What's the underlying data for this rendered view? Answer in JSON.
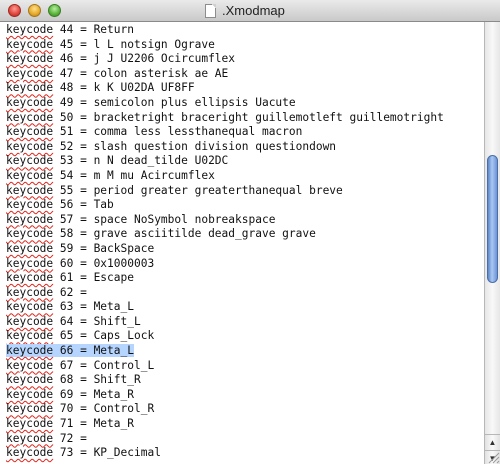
{
  "window": {
    "title": ".Xmodmap",
    "file_icon": "document-icon"
  },
  "editor": {
    "lines": [
      [
        "keycode",
        " 44 = Return"
      ],
      [
        "keycode",
        " 45 = l L notsign Ograve"
      ],
      [
        "keycode",
        " 46 = j J U2206 Ocircumflex"
      ],
      [
        "keycode",
        " 47 = colon asterisk ae AE"
      ],
      [
        "keycode",
        " 48 = k K U02DA UF8FF"
      ],
      [
        "keycode",
        " 49 = semicolon plus ellipsis Uacute"
      ],
      [
        "keycode",
        " 50 = bracketright braceright guillemotleft guillemotright"
      ],
      [
        "keycode",
        " 51 = comma less lessthanequal macron"
      ],
      [
        "keycode",
        " 52 = slash question division questiondown"
      ],
      [
        "keycode",
        " 53 = n N dead_tilde U02DC"
      ],
      [
        "keycode",
        " 54 = m M mu Acircumflex"
      ],
      [
        "keycode",
        " 55 = period greater greaterthanequal breve"
      ],
      [
        "keycode",
        " 56 = Tab"
      ],
      [
        "keycode",
        " 57 = space NoSymbol nobreakspace"
      ],
      [
        "keycode",
        " 58 = grave asciitilde dead_grave grave"
      ],
      [
        "keycode",
        " 59 = BackSpace"
      ],
      [
        "keycode",
        " 60 = 0x1000003"
      ],
      [
        "keycode",
        " 61 = Escape"
      ],
      [
        "keycode",
        " 62 ="
      ],
      [
        "keycode",
        " 63 = Meta_L"
      ],
      [
        "keycode",
        " 64 = Shift_L"
      ],
      [
        "keycode",
        " 65 = Caps_Lock"
      ],
      [
        "keycode",
        " 66 = Meta_L"
      ],
      [
        "keycode",
        " 67 = Control_L"
      ],
      [
        "keycode",
        " 68 = Shift_R"
      ],
      [
        "keycode",
        " 69 = Meta_R"
      ],
      [
        "keycode",
        " 70 = Control_R"
      ],
      [
        "keycode",
        " 71 = Meta_R"
      ],
      [
        "keycode",
        " 72 ="
      ],
      [
        "keycode",
        " 73 = KP_Decimal"
      ]
    ],
    "selected_line_index": 22
  },
  "scrollbar": {
    "up_arrow": "▲",
    "down_arrow": "▼"
  }
}
